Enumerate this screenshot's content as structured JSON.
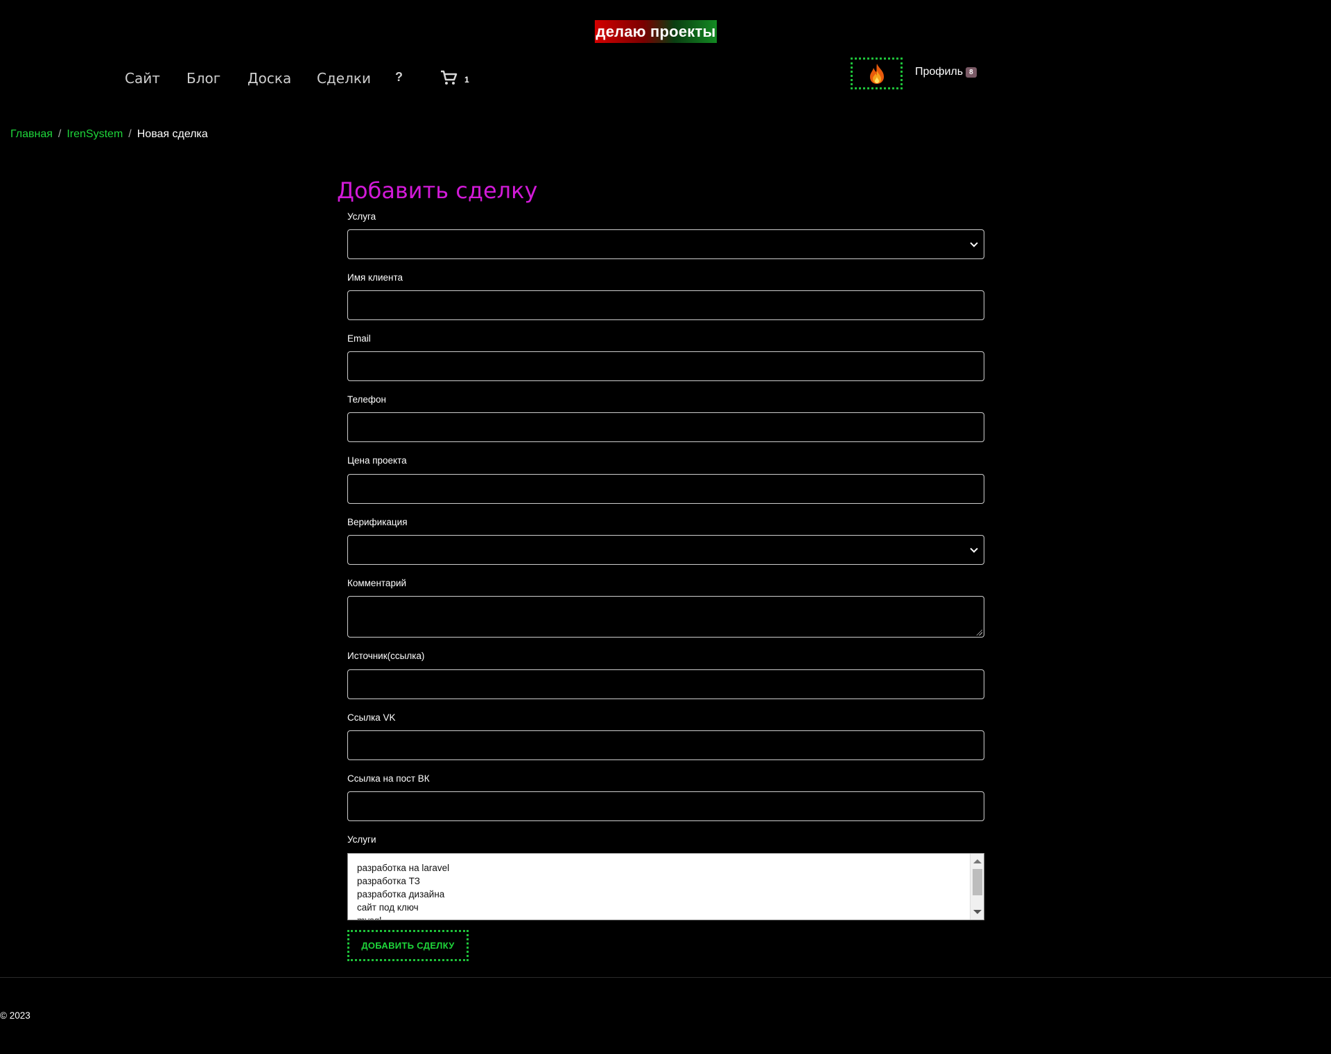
{
  "header": {
    "logo_text": "делаю проекты",
    "nav": [
      {
        "label": "Сайт"
      },
      {
        "label": "Блог"
      },
      {
        "label": "Доска"
      },
      {
        "label": "Сделки"
      }
    ],
    "help_label": "?",
    "cart_icon": "cart-icon",
    "cart_count": "1",
    "fire_icon": "fire-icon",
    "profile_label": "Профиль",
    "profile_badge": "8"
  },
  "breadcrumb": {
    "items": [
      "Главная",
      "IrenSystem"
    ],
    "separator": "/",
    "current": "Новая сделка"
  },
  "form": {
    "title": "Добавить сделку",
    "fields": {
      "service": {
        "label": "Услуга",
        "value": ""
      },
      "client_name": {
        "label": "Имя клиента",
        "value": ""
      },
      "email": {
        "label": "Email",
        "value": ""
      },
      "phone": {
        "label": "Телефон",
        "value": ""
      },
      "price": {
        "label": "Цена проекта",
        "value": ""
      },
      "verification": {
        "label": "Верификация",
        "value": ""
      },
      "comment": {
        "label": "Комментарий",
        "value": ""
      },
      "source": {
        "label": "Источник(ссылка)",
        "value": ""
      },
      "vk_link": {
        "label": "Ссылка VK",
        "value": ""
      },
      "vk_post": {
        "label": "Ссылка на пост ВК",
        "value": ""
      }
    },
    "services_list": {
      "label": "Услуги",
      "options": [
        "разработка на laravel",
        "разработка ТЗ",
        "разработка дизайна",
        "сайт под ключ",
        "mysql"
      ]
    },
    "submit_label": "ДОБАВИТЬ СДЕЛКУ"
  },
  "footer": {
    "copyright": "© 2023"
  },
  "colors": {
    "background": "#000000",
    "accent_green": "#1ed63a",
    "title_magenta": "#d21ad8"
  }
}
